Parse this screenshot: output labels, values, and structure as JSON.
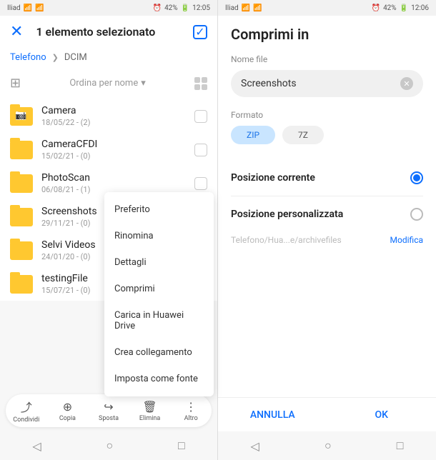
{
  "left": {
    "status": {
      "carrier": "Iliad",
      "battery": "42%",
      "time": "12:05"
    },
    "header": {
      "title": "1 elemento selezionato"
    },
    "breadcrumb": {
      "root": "Telefono",
      "current": "DCIM"
    },
    "sort": {
      "label": "Ordina per nome"
    },
    "items": [
      {
        "name": "Camera",
        "sub": "18/05/22 - (2)",
        "camera": true
      },
      {
        "name": "CameraCFDI",
        "sub": "15/02/21 - (0)"
      },
      {
        "name": "PhotoScan",
        "sub": "06/08/21 - (1)"
      },
      {
        "name": "Screenshots",
        "sub": "29/11/21 - (0)"
      },
      {
        "name": "Selvi Videos",
        "sub": "24/01/20 - (0)"
      },
      {
        "name": "testingFile",
        "sub": "15/07/21 - (0)"
      }
    ],
    "menu": [
      "Preferito",
      "Rinomina",
      "Dettagli",
      "Comprimi",
      "Carica in Huawei Drive",
      "Crea collegamento",
      "Imposta come fonte"
    ],
    "bottom": [
      {
        "label": "Condividi"
      },
      {
        "label": "Copia"
      },
      {
        "label": "Sposta"
      },
      {
        "label": "Elimina"
      },
      {
        "label": "Altro"
      }
    ]
  },
  "right": {
    "status": {
      "carrier": "Iliad",
      "battery": "42%",
      "time": "12:06"
    },
    "title": "Comprimi in",
    "filename_label": "Nome file",
    "filename": "Screenshots",
    "format_label": "Formato",
    "formats": {
      "zip": "ZIP",
      "sevenz": "7Z"
    },
    "pos_current": "Posizione corrente",
    "pos_custom": "Posizione personalizzata",
    "path": "Telefono/Hua...e/archivefiles",
    "edit": "Modifica",
    "cancel": "ANNULLA",
    "ok": "OK"
  }
}
